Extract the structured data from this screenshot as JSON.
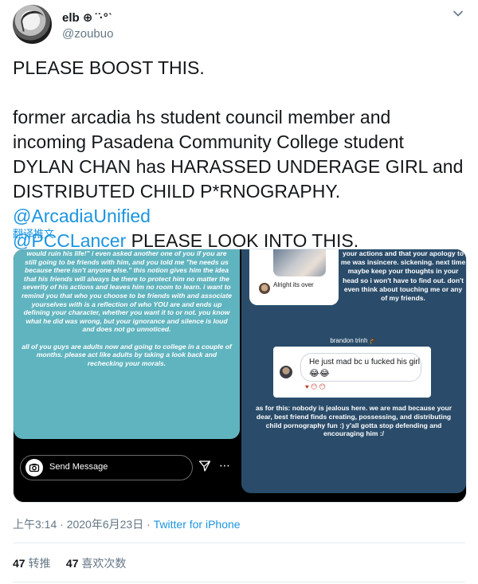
{
  "user": {
    "name": "elb ⊕ ̇ ̇·°ˋ",
    "handle": "@zoubuo"
  },
  "tweet": {
    "line1": "PLEASE BOOST THIS.",
    "body": "former arcadia hs student council member and incoming Pasadena Community College student DYLAN CHAN has HARASSED UNDERAGE GIRL and DISTRIBUTED CHILD P*RNOGRAPHY. ",
    "mention1": "@ArcadiaUnified",
    "mention2": "@PCCLancer",
    "tail": " PLEASE LOOK INTO THIS.",
    "translate": "翻译推文"
  },
  "story_left": {
    "text": "would ruin his life!\" i even asked another one of you if you are still going to be friends with him, and you told me \"he needs us because there isn't anyone else.\" this notion gives him the idea that his friends will always be there to protect him no matter the severity of his actions and leaves him no room to learn. i want to remind you that who you choose to be friends with and associate yourselves with is a reflection of who YOU are and ends up defining your character, whether you want it to or not. you know what he did was wrong, but your ignorance and silence is loud and does not go unnoticed.\n\nall of you guys are adults now and going to college in a couple of months. please act like adults by taking a look back and rechecking your morals.",
    "send_label": "Send Message",
    "more_dots": "⋯"
  },
  "story_right": {
    "top_text": "your actions and that your apology to me was insincere. sickening. next time maybe keep your thoughts in your head so i won't have to find out. don't even think about touching me or any of my friends.",
    "alright": "Alright its over",
    "dm_name": "brandon trinh",
    "dm_hat": "🎓",
    "bubble_text": "He just mad bc u fucked his girl",
    "bubble_emoji": "😂😂",
    "reacts": "♥ 😶 😶",
    "bottom_text": "as for this: nobody is jealous here. we are mad because your dear, best friend finds creating, possessing, and distributing child pornography fun :) y'all gotta stop defending and encouraging him :/"
  },
  "meta": {
    "time": "上午3:14 · 2020年6月23日 · ",
    "source": "Twitter for iPhone"
  },
  "stats": {
    "retweets": "47",
    "retweets_label": "转推",
    "likes": "47",
    "likes_label": "喜欢次数"
  },
  "icons": {
    "more": "chevron-down-icon",
    "camera": "camera-icon",
    "send": "paper-plane-icon"
  }
}
